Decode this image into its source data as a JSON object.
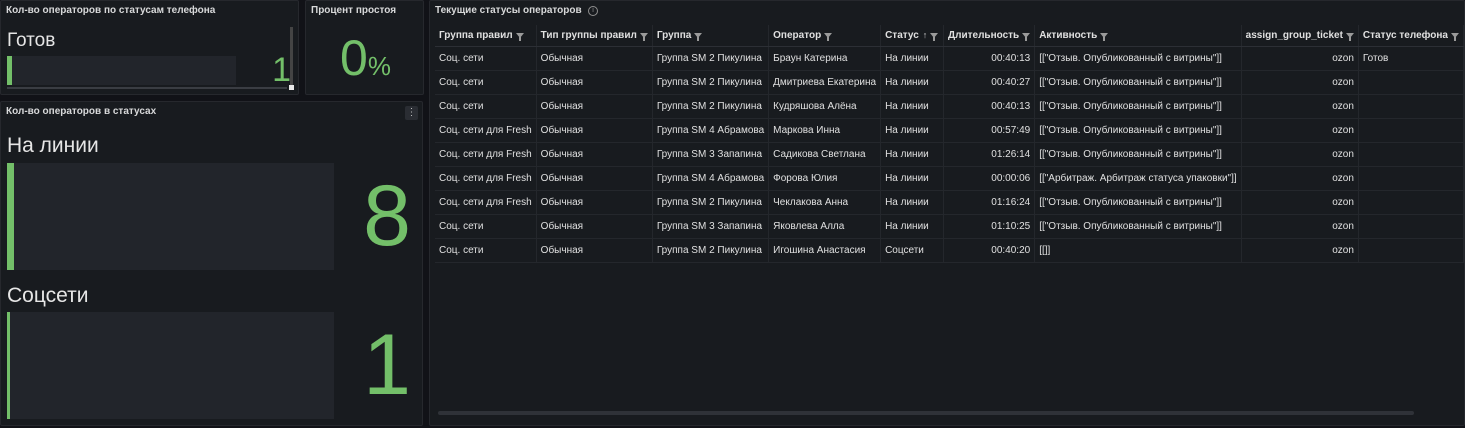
{
  "colors": {
    "accent_green": "#73bf69",
    "panel_bg": "#181b1f",
    "page_bg": "#111217"
  },
  "phone_panel": {
    "title": "Кол-во операторов по статусам телефона",
    "label": "Готов",
    "value": "1",
    "fill_fraction": 0.02
  },
  "idle_panel": {
    "title": "Процент простоя",
    "value": "0",
    "unit": "%"
  },
  "status_panel": {
    "title": "Кол-во операторов в статусах",
    "menu_icon": "ellipsis-vertical-icon",
    "items": [
      {
        "label": "На линии",
        "value": "8",
        "fill_fraction": 0.02
      },
      {
        "label": "Соцсети",
        "value": "1",
        "fill_fraction": 0.01
      }
    ]
  },
  "table_panel": {
    "title": "Текущие статусы операторов",
    "info_icon": "info-icon",
    "columns": [
      "Группа правил",
      "Тип группы правил",
      "Группа",
      "Оператор",
      "Статус",
      "Длительность",
      "Активность",
      "assign_group_ticket",
      "Статус телефона"
    ],
    "rows": [
      [
        "Соц. сети",
        "Обычная",
        "Группа SM 2 Пикулина",
        "Браун Катерина",
        "На линии",
        "00:40:13",
        "[[\"Отзыв. Опубликованный с витрины\"]]",
        "ozon",
        "Готов"
      ],
      [
        "Соц. сети",
        "Обычная",
        "Группа SM 2 Пикулина",
        "Дмитриева Екатерина",
        "На линии",
        "00:40:27",
        "[[\"Отзыв. Опубликованный с витрины\"]]",
        "ozon",
        ""
      ],
      [
        "Соц. сети",
        "Обычная",
        "Группа SM 2 Пикулина",
        "Кудряшова Алёна",
        "На линии",
        "00:40:13",
        "[[\"Отзыв. Опубликованный с витрины\"]]",
        "ozon",
        ""
      ],
      [
        "Соц. сети для Fresh",
        "Обычная",
        "Группа SM 4 Абрамова",
        "Маркова Инна",
        "На линии",
        "00:57:49",
        "[[\"Отзыв. Опубликованный с витрины\"]]",
        "ozon",
        ""
      ],
      [
        "Соц. сети для Fresh",
        "Обычная",
        "Группа SM 3 Запапина",
        "Садикова Светлана",
        "На линии",
        "01:26:14",
        "[[\"Отзыв. Опубликованный с витрины\"]]",
        "ozon",
        ""
      ],
      [
        "Соц. сети для Fresh",
        "Обычная",
        "Группа SM 4 Абрамова",
        "Форова Юлия",
        "На линии",
        "00:00:06",
        "[[\"Арбитраж. Арбитраж статуса упаковки\"]]",
        "ozon",
        ""
      ],
      [
        "Соц. сети для Fresh",
        "Обычная",
        "Группа SM 2 Пикулина",
        "Чеклакова Анна",
        "На линии",
        "01:16:24",
        "[[\"Отзыв. Опубликованный с витрины\"]]",
        "ozon",
        ""
      ],
      [
        "Соц. сети",
        "Обычная",
        "Группа SM 3 Запапина",
        "Яковлева Алла",
        "На линии",
        "01:10:25",
        "[[\"Отзыв. Опубликованный с витрины\"]]",
        "ozon",
        ""
      ],
      [
        "Соц. сети",
        "Обычная",
        "Группа SM 2 Пикулина",
        "Игошина Анастасия",
        "Соцсети",
        "00:40:20",
        "[[]]",
        "ozon",
        ""
      ]
    ]
  }
}
